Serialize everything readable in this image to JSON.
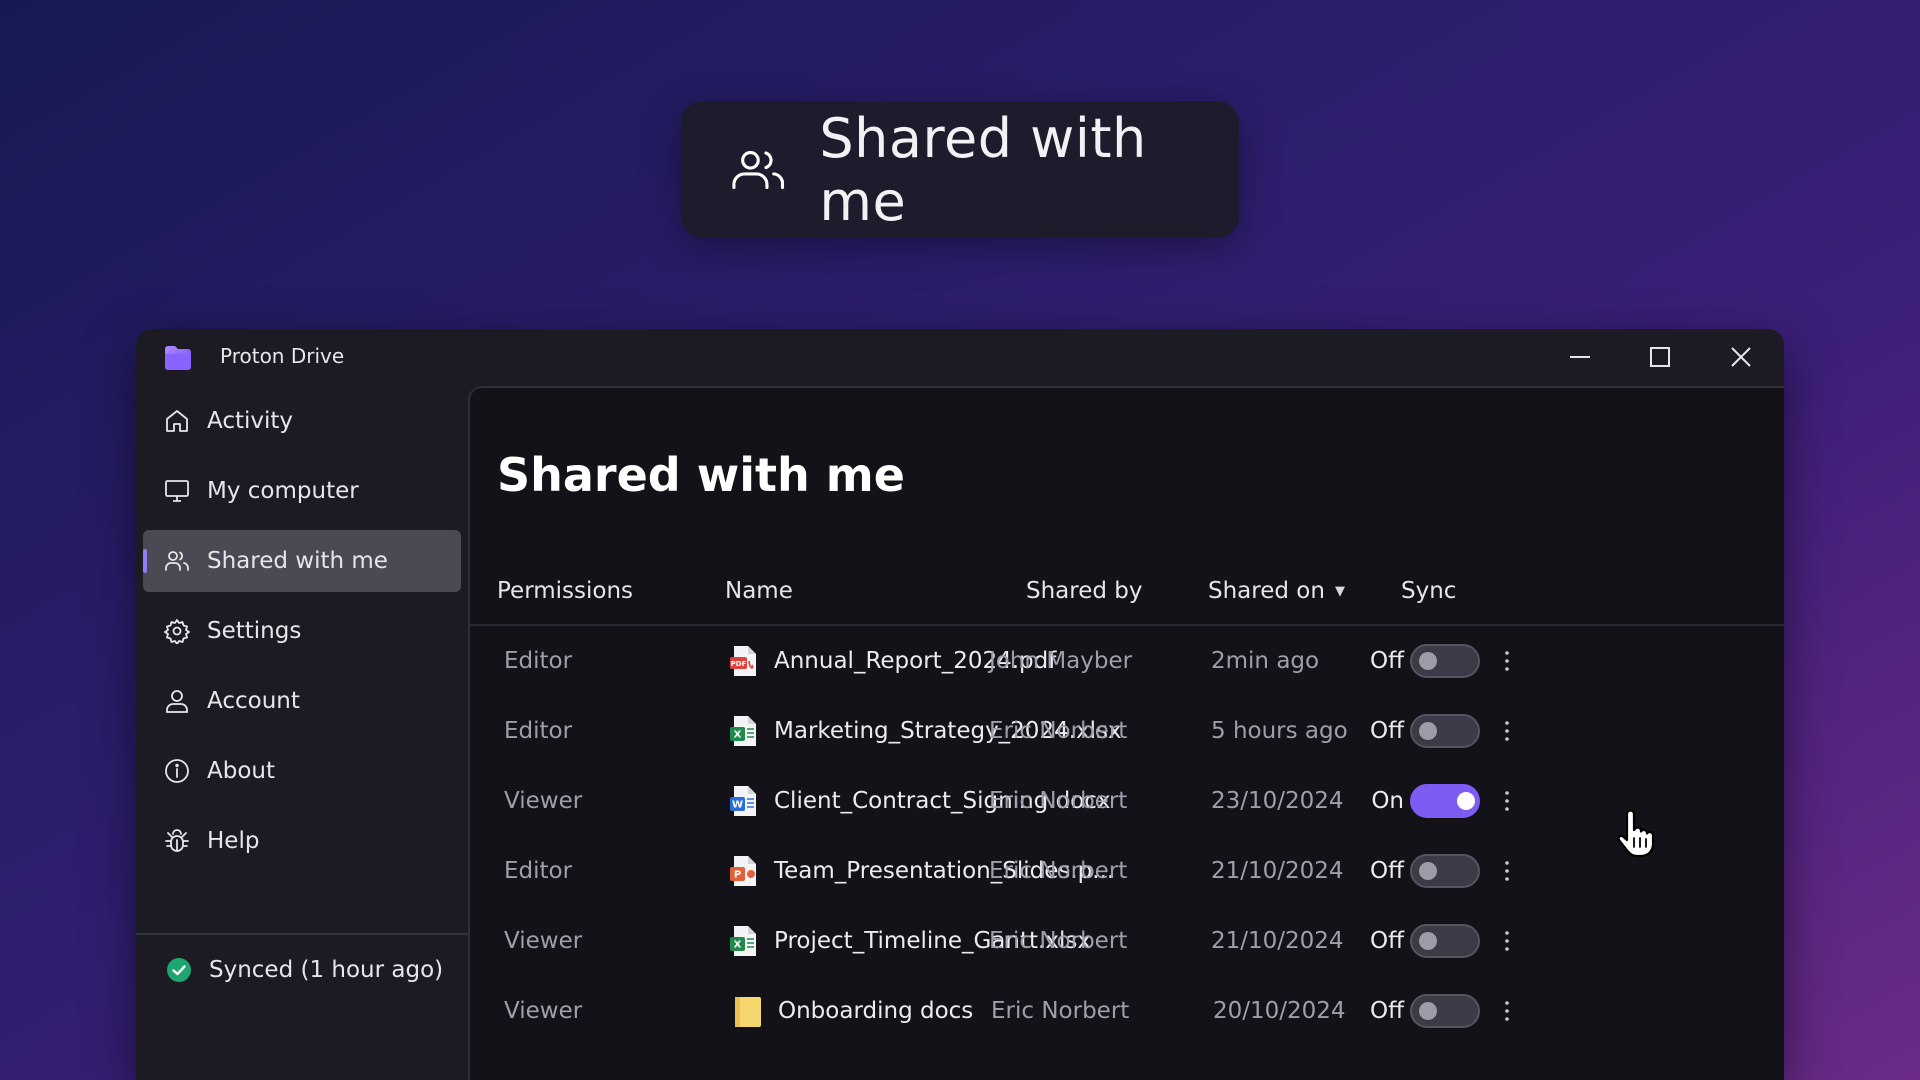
{
  "banner": {
    "title": "Shared with me",
    "icon": "users-icon"
  },
  "app": {
    "title": "Proton Drive",
    "logo": "proton-drive-logo"
  },
  "window_controls": [
    "minimize-icon",
    "maximize-icon",
    "close-icon"
  ],
  "sidebar": {
    "items": [
      {
        "label": "Activity",
        "icon": "home-icon",
        "active": false
      },
      {
        "label": "My computer",
        "icon": "monitor-icon",
        "active": false
      },
      {
        "label": "Shared with me",
        "icon": "users-icon",
        "active": true
      },
      {
        "label": "Settings",
        "icon": "gear-icon",
        "active": false
      },
      {
        "label": "Account",
        "icon": "user-icon",
        "active": false
      },
      {
        "label": "About",
        "icon": "info-icon",
        "active": false
      },
      {
        "label": "Help",
        "icon": "bug-icon",
        "active": false
      }
    ],
    "sync_status": "Synced (1 hour ago)"
  },
  "main": {
    "title": "Shared with me",
    "columns": {
      "permissions": "Permissions",
      "name": "Name",
      "shared_by": "Shared by",
      "shared_on": "Shared on",
      "sync": "Sync"
    },
    "rows": [
      {
        "permission": "Editor",
        "name": "Annual_Report_2024.pdf",
        "type": "pdf",
        "shared_by": "John Mayber",
        "shared_on": "2min ago",
        "sync_label": "Off",
        "sync": false
      },
      {
        "permission": "Editor",
        "name": "Marketing_Strategy_2024.xlsx",
        "type": "xlsx",
        "shared_by": "Eric Norbert",
        "shared_on": "5 hours ago",
        "sync_label": "Off",
        "sync": false
      },
      {
        "permission": "Viewer",
        "name": "Client_Contract_Signing.docx",
        "type": "docx",
        "shared_by": "Eric Norbert",
        "shared_on": "23/10/2024",
        "sync_label": "On",
        "sync": true
      },
      {
        "permission": "Editor",
        "name": "Team_Presentation_Slides.p...",
        "type": "pptx",
        "shared_by": "Eric Norbert",
        "shared_on": "21/10/2024",
        "sync_label": "Off",
        "sync": false
      },
      {
        "permission": "Viewer",
        "name": "Project_Timeline_Gantt.xlsx",
        "type": "xlsx",
        "shared_by": "Eric Norbert",
        "shared_on": "21/10/2024",
        "sync_label": "Off",
        "sync": false
      },
      {
        "permission": "Viewer",
        "name": "Onboarding docs",
        "type": "folder",
        "shared_by": "Eric Norbert",
        "shared_on": "20/10/2024",
        "sync_label": "Off",
        "sync": false
      }
    ]
  },
  "colors": {
    "accent": "#7c5cf2",
    "sync_ok": "#1ea672",
    "pdf": "#e0403a",
    "xlsx": "#1f8a4c",
    "docx": "#2b6fd6",
    "pptx": "#e0613a",
    "folder": "#f5d76e"
  }
}
